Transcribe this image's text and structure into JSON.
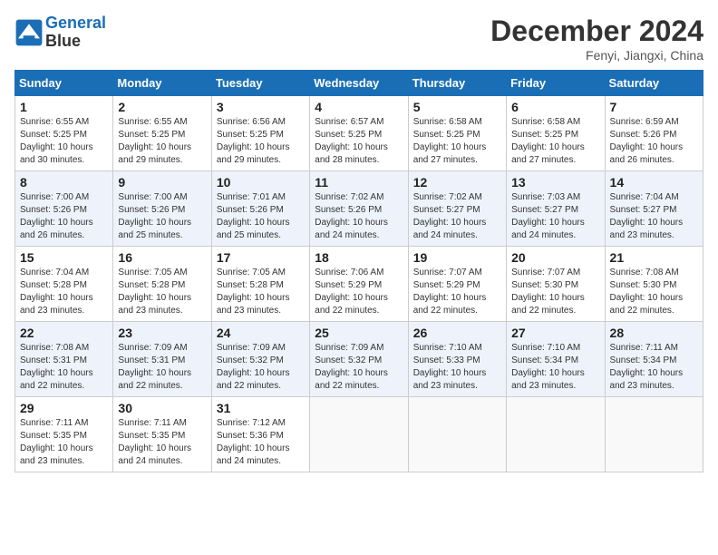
{
  "header": {
    "logo_line1": "General",
    "logo_line2": "Blue",
    "month": "December 2024",
    "location": "Fenyi, Jiangxi, China"
  },
  "weekdays": [
    "Sunday",
    "Monday",
    "Tuesday",
    "Wednesday",
    "Thursday",
    "Friday",
    "Saturday"
  ],
  "weeks": [
    [
      {
        "day": "1",
        "sunrise": "6:55 AM",
        "sunset": "5:25 PM",
        "daylight": "10 hours and 30 minutes."
      },
      {
        "day": "2",
        "sunrise": "6:55 AM",
        "sunset": "5:25 PM",
        "daylight": "10 hours and 29 minutes."
      },
      {
        "day": "3",
        "sunrise": "6:56 AM",
        "sunset": "5:25 PM",
        "daylight": "10 hours and 29 minutes."
      },
      {
        "day": "4",
        "sunrise": "6:57 AM",
        "sunset": "5:25 PM",
        "daylight": "10 hours and 28 minutes."
      },
      {
        "day": "5",
        "sunrise": "6:58 AM",
        "sunset": "5:25 PM",
        "daylight": "10 hours and 27 minutes."
      },
      {
        "day": "6",
        "sunrise": "6:58 AM",
        "sunset": "5:25 PM",
        "daylight": "10 hours and 27 minutes."
      },
      {
        "day": "7",
        "sunrise": "6:59 AM",
        "sunset": "5:26 PM",
        "daylight": "10 hours and 26 minutes."
      }
    ],
    [
      {
        "day": "8",
        "sunrise": "7:00 AM",
        "sunset": "5:26 PM",
        "daylight": "10 hours and 26 minutes."
      },
      {
        "day": "9",
        "sunrise": "7:00 AM",
        "sunset": "5:26 PM",
        "daylight": "10 hours and 25 minutes."
      },
      {
        "day": "10",
        "sunrise": "7:01 AM",
        "sunset": "5:26 PM",
        "daylight": "10 hours and 25 minutes."
      },
      {
        "day": "11",
        "sunrise": "7:02 AM",
        "sunset": "5:26 PM",
        "daylight": "10 hours and 24 minutes."
      },
      {
        "day": "12",
        "sunrise": "7:02 AM",
        "sunset": "5:27 PM",
        "daylight": "10 hours and 24 minutes."
      },
      {
        "day": "13",
        "sunrise": "7:03 AM",
        "sunset": "5:27 PM",
        "daylight": "10 hours and 24 minutes."
      },
      {
        "day": "14",
        "sunrise": "7:04 AM",
        "sunset": "5:27 PM",
        "daylight": "10 hours and 23 minutes."
      }
    ],
    [
      {
        "day": "15",
        "sunrise": "7:04 AM",
        "sunset": "5:28 PM",
        "daylight": "10 hours and 23 minutes."
      },
      {
        "day": "16",
        "sunrise": "7:05 AM",
        "sunset": "5:28 PM",
        "daylight": "10 hours and 23 minutes."
      },
      {
        "day": "17",
        "sunrise": "7:05 AM",
        "sunset": "5:28 PM",
        "daylight": "10 hours and 23 minutes."
      },
      {
        "day": "18",
        "sunrise": "7:06 AM",
        "sunset": "5:29 PM",
        "daylight": "10 hours and 22 minutes."
      },
      {
        "day": "19",
        "sunrise": "7:07 AM",
        "sunset": "5:29 PM",
        "daylight": "10 hours and 22 minutes."
      },
      {
        "day": "20",
        "sunrise": "7:07 AM",
        "sunset": "5:30 PM",
        "daylight": "10 hours and 22 minutes."
      },
      {
        "day": "21",
        "sunrise": "7:08 AM",
        "sunset": "5:30 PM",
        "daylight": "10 hours and 22 minutes."
      }
    ],
    [
      {
        "day": "22",
        "sunrise": "7:08 AM",
        "sunset": "5:31 PM",
        "daylight": "10 hours and 22 minutes."
      },
      {
        "day": "23",
        "sunrise": "7:09 AM",
        "sunset": "5:31 PM",
        "daylight": "10 hours and 22 minutes."
      },
      {
        "day": "24",
        "sunrise": "7:09 AM",
        "sunset": "5:32 PM",
        "daylight": "10 hours and 22 minutes."
      },
      {
        "day": "25",
        "sunrise": "7:09 AM",
        "sunset": "5:32 PM",
        "daylight": "10 hours and 22 minutes."
      },
      {
        "day": "26",
        "sunrise": "7:10 AM",
        "sunset": "5:33 PM",
        "daylight": "10 hours and 23 minutes."
      },
      {
        "day": "27",
        "sunrise": "7:10 AM",
        "sunset": "5:34 PM",
        "daylight": "10 hours and 23 minutes."
      },
      {
        "day": "28",
        "sunrise": "7:11 AM",
        "sunset": "5:34 PM",
        "daylight": "10 hours and 23 minutes."
      }
    ],
    [
      {
        "day": "29",
        "sunrise": "7:11 AM",
        "sunset": "5:35 PM",
        "daylight": "10 hours and 23 minutes."
      },
      {
        "day": "30",
        "sunrise": "7:11 AM",
        "sunset": "5:35 PM",
        "daylight": "10 hours and 24 minutes."
      },
      {
        "day": "31",
        "sunrise": "7:12 AM",
        "sunset": "5:36 PM",
        "daylight": "10 hours and 24 minutes."
      },
      null,
      null,
      null,
      null
    ]
  ]
}
